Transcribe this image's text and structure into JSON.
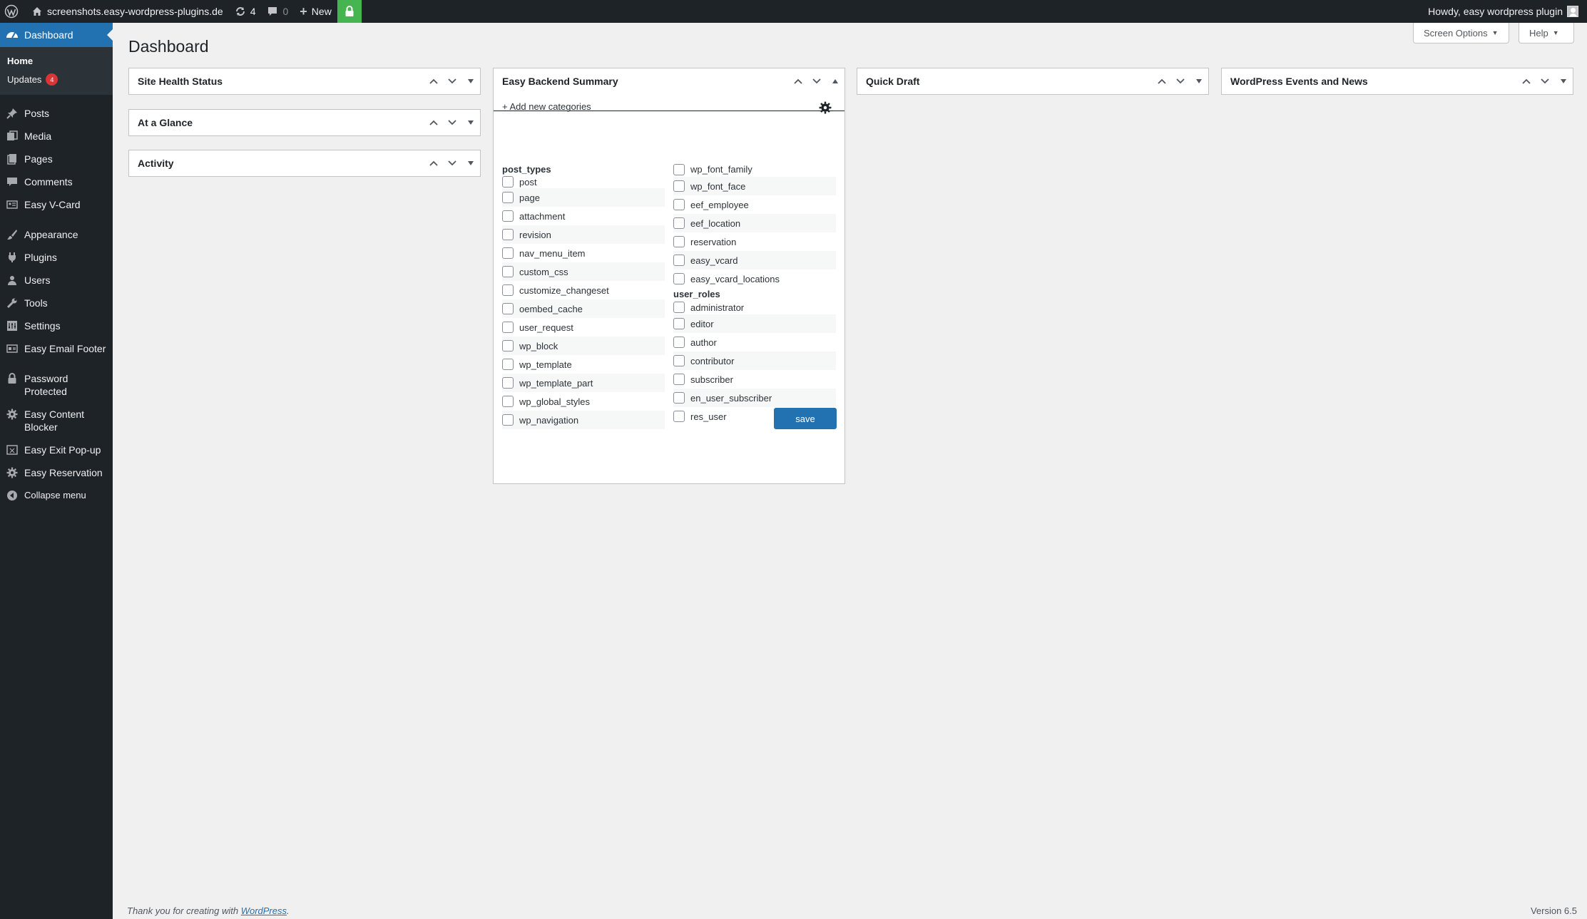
{
  "adminbar": {
    "site_name": "screenshots.easy-wordpress-plugins.de",
    "updates_count": "4",
    "comments_count": "0",
    "new_label": "New",
    "howdy": "Howdy, easy wordpress plugin"
  },
  "sidebar": {
    "dashboard": "Dashboard",
    "submenu": {
      "home": "Home",
      "updates": "Updates",
      "updates_badge": "4"
    },
    "items": [
      {
        "label": "Posts",
        "icon": "pushpin-icon"
      },
      {
        "label": "Media",
        "icon": "media-icon"
      },
      {
        "label": "Pages",
        "icon": "pages-icon"
      },
      {
        "label": "Comments",
        "icon": "comments-icon"
      },
      {
        "label": "Easy V-Card",
        "icon": "vcard-icon"
      },
      {
        "label": "Appearance",
        "icon": "paintbrush-icon"
      },
      {
        "label": "Plugins",
        "icon": "plugin-icon"
      },
      {
        "label": "Users",
        "icon": "users-icon"
      },
      {
        "label": "Tools",
        "icon": "wrench-icon"
      },
      {
        "label": "Settings",
        "icon": "settings-icon"
      },
      {
        "label": "Easy Email Footer",
        "icon": "email-footer-icon"
      },
      {
        "label": "Password Protected",
        "icon": "lock-icon"
      },
      {
        "label": "Easy Content Blocker",
        "icon": "gear-icon"
      },
      {
        "label": "Easy Exit Pop-up",
        "icon": "popup-icon"
      },
      {
        "label": "Easy Reservation",
        "icon": "gear-icon"
      },
      {
        "label": "Collapse menu",
        "icon": "collapse-icon"
      }
    ]
  },
  "page": {
    "title": "Dashboard",
    "screen_options": "Screen Options",
    "help": "Help"
  },
  "widgets": {
    "site_health": "Site Health Status",
    "at_a_glance": "At a Glance",
    "activity": "Activity",
    "easy_backend_summary": "Easy Backend Summary",
    "quick_draft": "Quick Draft",
    "events_news": "WordPress Events and News"
  },
  "ebs": {
    "add_new": "+ Add new categories",
    "post_types_heading": "post_types",
    "post_types": [
      "post",
      "page",
      "attachment",
      "revision",
      "nav_menu_item",
      "custom_css",
      "customize_changeset",
      "oembed_cache",
      "user_request",
      "wp_block",
      "wp_template",
      "wp_template_part",
      "wp_global_styles",
      "wp_navigation"
    ],
    "more_post_types": [
      "wp_font_family",
      "wp_font_face",
      "eef_employee",
      "eef_location",
      "reservation",
      "easy_vcard",
      "easy_vcard_locations"
    ],
    "user_roles_heading": "user_roles",
    "user_roles": [
      "administrator",
      "editor",
      "author",
      "contributor",
      "subscriber",
      "en_user_subscriber",
      "res_user"
    ],
    "save_label": "save"
  },
  "footer": {
    "thanks": "Thank you for creating with ",
    "link": "WordPress",
    "period": ".",
    "version": "Version 6.5"
  }
}
